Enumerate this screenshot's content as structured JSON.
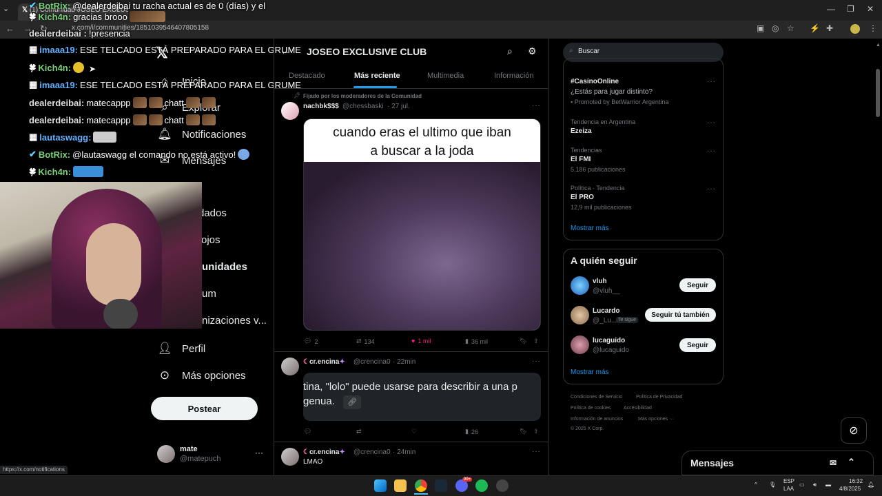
{
  "browser": {
    "tab_title": "(1) Comunidad JOSEO EXCLUS...",
    "url": "x.com/i/communities/1851039546407805158",
    "status_url": "https://x.com/notifications"
  },
  "chat": [
    {
      "user": "BotRix:",
      "msg": "@dealerdeibai tu racha actual es de 0 (días) y el"
    },
    {
      "user": "Kich4n:",
      "msg": "gracias brooo"
    },
    {
      "user": "dealerdeibai :",
      "msg": "!presencia"
    },
    {
      "user": "imaaa19:",
      "msg": "ESE TELCADO ESTÁ PREPARADO PARA EL GRUME"
    },
    {
      "user": "Kich4n:",
      "msg": ""
    },
    {
      "user": "imaaa19:",
      "msg": "ESE TELCADO ESTÁ PREPARADO PARA EL GRUME"
    },
    {
      "user": "dealerdeibai:",
      "msg": "matecappp"
    },
    {
      "user": "dealerdeibai:",
      "msg": "matecappp"
    },
    {
      "user": "lautaswagg:",
      "msg": ""
    },
    {
      "user": "BotRix:",
      "msg": "@lautaswagg el comando no está activo!"
    },
    {
      "user": "Kich4n:",
      "msg": ""
    }
  ],
  "chat_extra": {
    "chatt": "chatt"
  },
  "sidebar": {
    "items": [
      {
        "label": "Inicio",
        "icon": "home-icon"
      },
      {
        "label": "Explorar",
        "icon": "search-icon"
      },
      {
        "label": "Notificaciones",
        "icon": "bell-icon"
      },
      {
        "label": "Mensajes",
        "icon": "mail-icon"
      },
      {
        "label": "Guardados",
        "icon": "bookmark-icon"
      },
      {
        "label": "Empleos",
        "icon": "briefcase-icon"
      },
      {
        "label": "Comunidades",
        "icon": "people-icon"
      },
      {
        "label": "Premium",
        "icon": "x-logo-icon"
      },
      {
        "label": "Organizaciones v...",
        "icon": "lightning-icon"
      },
      {
        "label": "Perfil",
        "icon": "person-icon"
      },
      {
        "label": "Más opciones",
        "icon": "more-circle-icon"
      }
    ],
    "visible_labels": {
      "guardados": "dados",
      "empleos": "ojos",
      "comunidades": "unidades",
      "premium": "um",
      "orgs": "nizaciones v..."
    },
    "post_label": "Postear",
    "account_name": "mate",
    "account_handle": "@matepuch"
  },
  "community": {
    "title": "JOSEO EXCLUSIVE CLUB",
    "tabs": [
      "Destacado",
      "Más reciente",
      "Multimedia",
      "Información"
    ],
    "active_tab": "Más reciente"
  },
  "posts": [
    {
      "pinned": "Fijado por los moderadores de la Comunidad",
      "name": "nachbk$$$",
      "handle": "@chessbaski",
      "time": "· 27 jul.",
      "caption_line1": "cuando eras el ultimo que iban",
      "caption_line2": "a buscar a la joda",
      "replies": "2",
      "retweets": "134",
      "likes": "1 mil",
      "views": "36 mil"
    },
    {
      "name": "cr.encina",
      "handle": "@crencina0",
      "time": "· 22min",
      "card_text_line1": "tina, \"lolo\" puede usarse para describir a una p",
      "card_text_line2": "genua.",
      "views": "26"
    },
    {
      "name": "cr.encina",
      "handle": "@crencina0",
      "time": "· 24min",
      "text": "LMAO"
    }
  ],
  "right": {
    "search_placeholder": "Buscar",
    "trends": [
      {
        "meta": "",
        "title": "#CasinoOnline",
        "sub": "¿Estás para jugar distinto?",
        "promo": "Promoted by BetWarrior Argentina"
      },
      {
        "meta": "Tendencia en Argentina",
        "title": "Ezeiza",
        "sub": ""
      },
      {
        "meta": "Tendencias",
        "title": "El FMI",
        "sub": "5.186 publicaciones"
      },
      {
        "meta": "Política · Tendencia",
        "title": "El PRO",
        "sub": "12,9 mil publicaciones"
      }
    ],
    "show_more": "Mostrar más",
    "who_to_follow_title": "A quién seguir",
    "follow": [
      {
        "name": "vluh",
        "handle": "@vluh__",
        "button": "Seguir"
      },
      {
        "name": "Lucardo",
        "handle": "@_Lu...",
        "badge": "Te sigue",
        "button": "Seguir tú también"
      },
      {
        "name": "lucaguido",
        "handle": "@lucaguido",
        "button": "Seguir"
      }
    ],
    "follow_more": "Mostrar más",
    "footer": [
      "Condiciones de Servicio",
      "Política de Privacidad",
      "Política de cookies",
      "Accesibilidad",
      "Información de anuncios",
      "Más opciones ···",
      "© 2025 X Corp."
    ]
  },
  "messages_drawer": {
    "title": "Mensajes"
  },
  "taskbar": {
    "lang1": "ESP",
    "lang2": "LAA",
    "time": "16:32",
    "date": "4/8/2025",
    "badge": "99+"
  }
}
